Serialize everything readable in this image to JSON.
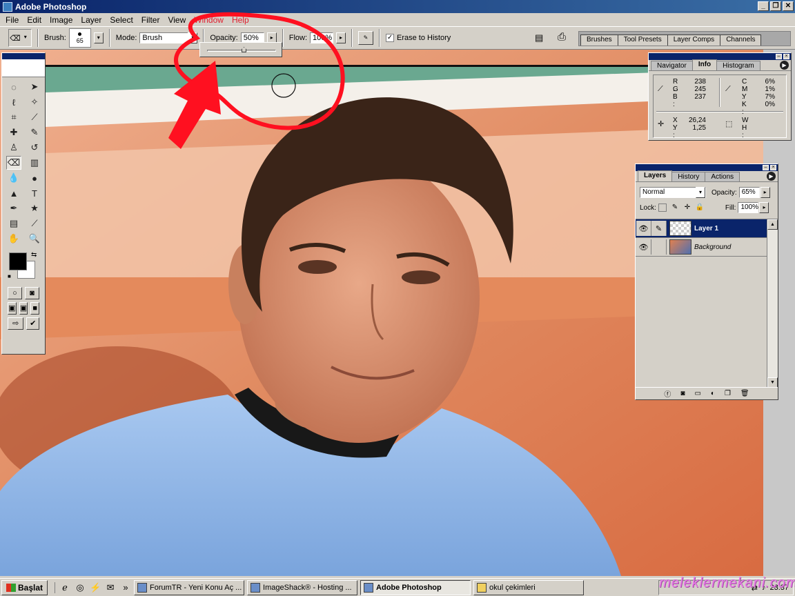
{
  "window": {
    "title": "Adobe Photoshop",
    "controls": [
      "_",
      "❐",
      "✕"
    ]
  },
  "menu": [
    "File",
    "Edit",
    "Image",
    "Layer",
    "Select",
    "Filter",
    "View",
    "Window",
    "Help"
  ],
  "options": {
    "brush_label": "Brush:",
    "brush_size": "65",
    "mode_label": "Mode:",
    "mode_value": "Brush",
    "opacity_label": "Opacity:",
    "opacity_value": "50%",
    "opacity_fraction": 0.5,
    "flow_label": "Flow:",
    "flow_value": "100%",
    "erase_history_label": "Erase to History",
    "erase_history_checked": "✓"
  },
  "palette_well_tabs": [
    "Brushes",
    "Tool Presets",
    "Layer Comps",
    "Channels"
  ],
  "info_panel": {
    "tabs": [
      "Navigator",
      "Info",
      "Histogram"
    ],
    "active_tab": "Info",
    "rgb": {
      "R": "238",
      "G": "245",
      "B": "237"
    },
    "cmyk": {
      "C": "6%",
      "M": "1%",
      "Y": "7%",
      "K": "0%"
    },
    "xy": {
      "X": "26,24",
      "Y": "1,25"
    },
    "wh": {
      "W": "",
      "H": ""
    }
  },
  "layers_panel": {
    "tabs": [
      "Layers",
      "History",
      "Actions"
    ],
    "active_tab": "Layers",
    "blend_mode": "Normal",
    "opacity_label": "Opacity:",
    "opacity_value": "65%",
    "lock_label": "Lock:",
    "fill_label": "Fill:",
    "fill_value": "100%",
    "layers": [
      {
        "name": "Layer 1",
        "selected": true
      },
      {
        "name": "Background",
        "selected": false,
        "locked": true
      }
    ]
  },
  "taskbar": {
    "start_label": "Başlat",
    "tasks": [
      {
        "label": "ForumTR - Yeni Konu Aç ..."
      },
      {
        "label": "ImageShack® - Hosting ..."
      },
      {
        "label": "Adobe Photoshop",
        "active": true
      },
      {
        "label": "okul çekimleri"
      }
    ],
    "quicklaunch_more": "»",
    "time": "23:37"
  },
  "watermark": "meleklermekani.com",
  "colors": {
    "title_blue": "#0a246a",
    "annotation_red": "#ff1020",
    "wall": "#e0825a",
    "shirt": "#90b8e8"
  }
}
